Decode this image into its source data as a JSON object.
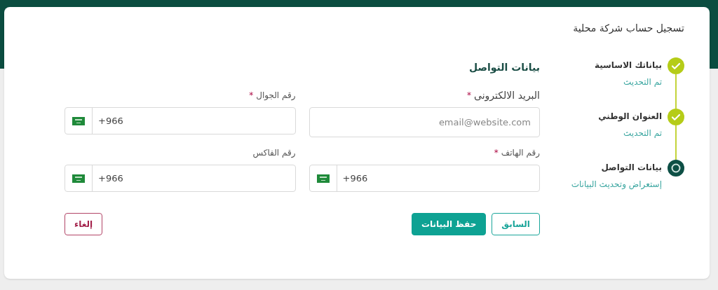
{
  "dialog": {
    "title": "تسجيل حساب شركة محلية"
  },
  "steps": [
    {
      "title": "بياناتك الاساسية",
      "status_text": "تم التحديث",
      "completed": true
    },
    {
      "title": "العنوان الوطني",
      "status_text": "تم التحديث",
      "completed": true
    },
    {
      "title": "بيانات التواصل",
      "status_text": "إستعراض وتحديث البيانات",
      "completed": false
    }
  ],
  "section_title": "بيانات التواصل",
  "fields": [
    {
      "label": "البريد الالكترونى",
      "required_mark": "*",
      "kind": "email",
      "placeholder": "email@website.com"
    },
    {
      "label": "رقم الجوال",
      "required_mark": "*",
      "kind": "phone",
      "value": "+966"
    },
    {
      "label": "رقم الهاتف",
      "required_mark": "*",
      "kind": "phone",
      "value": "+966"
    },
    {
      "label": "رقم الفاكس",
      "kind": "phone",
      "value": "+966"
    }
  ],
  "buttons": [
    {
      "label": "السابق",
      "kind": "outline"
    },
    {
      "label": "حفظ البيانات",
      "kind": "primary"
    },
    {
      "label": "إلغاء",
      "kind": "danger"
    }
  ]
}
